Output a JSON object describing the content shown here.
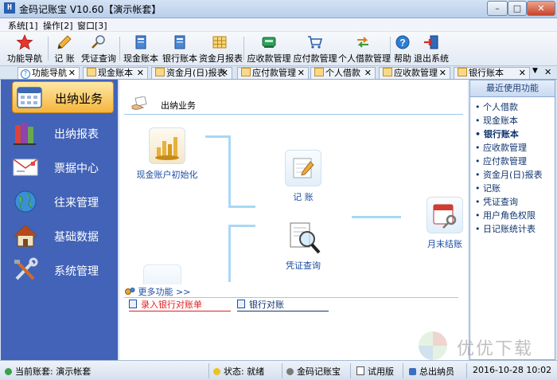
{
  "window": {
    "title": "金码记账宝  V10.60【演示帐套】",
    "controls": [
      "–",
      "□",
      "✕"
    ]
  },
  "menu": [
    "系统[1]",
    "操作[2]",
    "窗口[3]"
  ],
  "toolbar": [
    {
      "label": "功能导航",
      "icon": "star-icon"
    },
    {
      "label": "记  账",
      "icon": "pencil-icon"
    },
    {
      "label": "凭证查询",
      "icon": "magnifier-icon"
    },
    {
      "label": "现金账本",
      "icon": "ledger-icon"
    },
    {
      "label": "银行账本",
      "icon": "ledger-icon"
    },
    {
      "label": "资金月报表",
      "icon": "grid-table-icon"
    },
    {
      "label": "应收款管理",
      "icon": "receivable-icon"
    },
    {
      "label": "应付款管理",
      "icon": "cart-icon"
    },
    {
      "label": "个人借款管理",
      "icon": "exchange-icon"
    },
    {
      "label": "帮助",
      "icon": "help-icon"
    },
    {
      "label": "退出系统",
      "icon": "exit-icon"
    }
  ],
  "tabs": [
    {
      "label": "功能导航",
      "active": true
    },
    {
      "label": "现金账本"
    },
    {
      "label": "资金月(日)报表"
    },
    {
      "label": "应付款管理"
    },
    {
      "label": "个人借款"
    },
    {
      "label": "应收款管理"
    },
    {
      "label": "银行账本"
    }
  ],
  "tab_close": "✕",
  "tab_overflow": "▼",
  "tab_pin": "✕",
  "nav": [
    {
      "label": "出纳业务",
      "icon": "calendar-icon",
      "active": true
    },
    {
      "label": "出纳报表",
      "icon": "books-icon"
    },
    {
      "label": "票据中心",
      "icon": "envelope-icon"
    },
    {
      "label": "往来管理",
      "icon": "globe-icon"
    },
    {
      "label": "基础数据",
      "icon": "house-icon"
    },
    {
      "label": "系统管理",
      "icon": "tools-icon"
    }
  ],
  "main": {
    "section_title": "出纳业务",
    "nodes": [
      {
        "label": "现金账户初始化",
        "icon": "coins-chart-icon"
      },
      {
        "label": "记  账",
        "icon": "notebook-pen-icon"
      },
      {
        "label": "凭证查询",
        "icon": "document-magnifier-icon"
      },
      {
        "label": "月末结账",
        "icon": "calendar-key-icon"
      }
    ],
    "more_title": "更多功能 >>",
    "more_links": [
      {
        "label": "录入银行对账单",
        "color": "#e02020"
      },
      {
        "label": "银行对账",
        "color": "#10346e"
      }
    ]
  },
  "recent": {
    "title": "最近使用功能",
    "items": [
      {
        "label": "个人借款"
      },
      {
        "label": "现金账本"
      },
      {
        "label": "银行账本",
        "bold": true
      },
      {
        "label": "应收款管理"
      },
      {
        "label": "应付款管理"
      },
      {
        "label": "资金月(日)报表"
      },
      {
        "label": "记账"
      },
      {
        "label": "凭证查询"
      },
      {
        "label": "用户角色权限"
      },
      {
        "label": "日记账统计表"
      }
    ]
  },
  "status": {
    "account": "当前账套: 演示帐套",
    "state": "状态: 就绪",
    "app": "金码记账宝",
    "edition": "试用版",
    "user": "总出纳员",
    "datetime": "2016-10-28  10:02"
  },
  "watermark": "优优下载",
  "colors": {
    "nav_bg": "#4263b7",
    "active_nav": "#f5b53b",
    "flow_line": "#a9d8f6",
    "link_red": "#e02020",
    "link_blue": "#1c4fa3"
  }
}
